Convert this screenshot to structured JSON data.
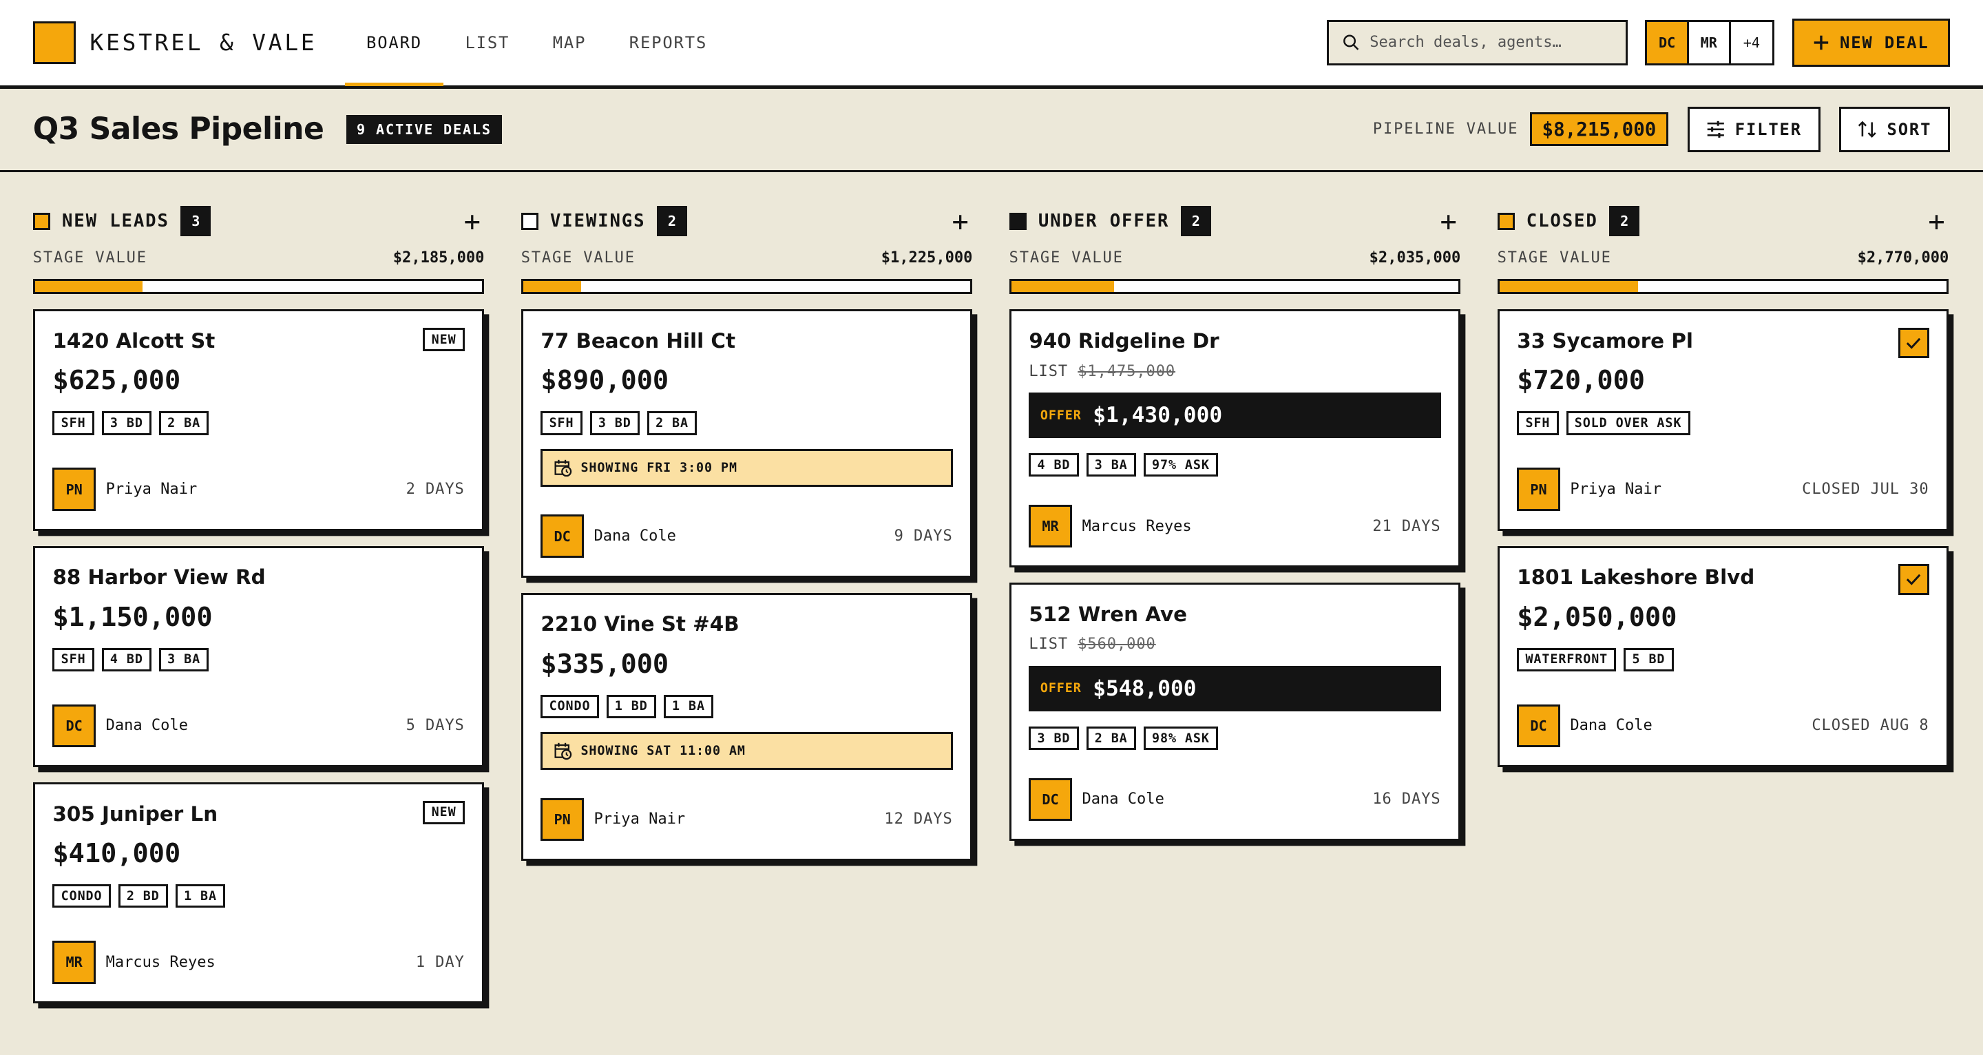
{
  "brand": {
    "name": "KESTREL & VALE"
  },
  "nav": {
    "tabs": [
      {
        "label": "BOARD",
        "active": true
      },
      {
        "label": "LIST"
      },
      {
        "label": "MAP"
      },
      {
        "label": "REPORTS"
      }
    ]
  },
  "search": {
    "placeholder": "Search deals, agents…"
  },
  "team": {
    "avatars": [
      "DC",
      "MR"
    ],
    "more": "+4"
  },
  "actions": {
    "new_deal": "NEW DEAL",
    "filter": "FILTER",
    "sort": "SORT"
  },
  "page": {
    "title": "Q3 Sales Pipeline",
    "active_badge": "9 ACTIVE DEALS",
    "pipeline_label": "PIPELINE VALUE",
    "pipeline_value": "$8,215,000"
  },
  "colors": {
    "accent": "#f5a70c",
    "ink": "#141414",
    "background": "#ece8d9",
    "showing": "#fbe0a3"
  },
  "columns": [
    {
      "title": "NEW LEADS",
      "count": "3",
      "marker": "accent",
      "stage_label": "STAGE VALUE",
      "stage_value": "$2,185,000",
      "progress": 0.24,
      "cards": [
        {
          "address": "1420 Alcott St",
          "price": "$625,000",
          "badge": "NEW",
          "tags": [
            "SFH",
            "3 BD",
            "2 BA"
          ],
          "agent_initials": "PN",
          "agent": "Priya Nair",
          "age": "2 DAYS"
        },
        {
          "address": "88 Harbor View Rd",
          "price": "$1,150,000",
          "tags": [
            "SFH",
            "4 BD",
            "3 BA"
          ],
          "agent_initials": "DC",
          "agent": "Dana Cole",
          "age": "5 DAYS"
        },
        {
          "address": "305 Juniper Ln",
          "price": "$410,000",
          "badge": "NEW",
          "tags": [
            "CONDO",
            "2 BD",
            "1 BA"
          ],
          "agent_initials": "MR",
          "agent": "Marcus Reyes",
          "age": "1 DAY"
        }
      ]
    },
    {
      "title": "VIEWINGS",
      "count": "2",
      "marker": "outline",
      "stage_label": "STAGE VALUE",
      "stage_value": "$1,225,000",
      "progress": 0.13,
      "cards": [
        {
          "address": "77 Beacon Hill Ct",
          "price": "$890,000",
          "tags": [
            "SFH",
            "3 BD",
            "2 BA"
          ],
          "showing": "SHOWING FRI 3:00 PM",
          "agent_initials": "DC",
          "agent": "Dana Cole",
          "age": "9 DAYS"
        },
        {
          "address": "2210 Vine St #4B",
          "price": "$335,000",
          "tags": [
            "CONDO",
            "1 BD",
            "1 BA"
          ],
          "showing": "SHOWING SAT 11:00 AM",
          "agent_initials": "PN",
          "agent": "Priya Nair",
          "age": "12 DAYS"
        }
      ]
    },
    {
      "title": "UNDER OFFER",
      "count": "2",
      "marker": "ink",
      "stage_label": "STAGE VALUE",
      "stage_value": "$2,035,000",
      "progress": 0.23,
      "cards": [
        {
          "address": "940 Ridgeline Dr",
          "list_label": "LIST",
          "list_price": "$1,475,000",
          "offer_label": "OFFER",
          "offer_price": "$1,430,000",
          "tags": [
            "4 BD",
            "3 BA",
            "97% ASK"
          ],
          "agent_initials": "MR",
          "agent": "Marcus Reyes",
          "age": "21 DAYS"
        },
        {
          "address": "512 Wren Ave",
          "list_label": "LIST",
          "list_price": "$560,000",
          "offer_label": "OFFER",
          "offer_price": "$548,000",
          "tags": [
            "3 BD",
            "2 BA",
            "98% ASK"
          ],
          "agent_initials": "DC",
          "agent": "Dana Cole",
          "age": "16 DAYS"
        }
      ]
    },
    {
      "title": "CLOSED",
      "count": "2",
      "marker": "accent",
      "stage_label": "STAGE VALUE",
      "stage_value": "$2,770,000",
      "progress": 0.31,
      "cards": [
        {
          "address": "33 Sycamore Pl",
          "price": "$720,000",
          "checked": true,
          "tags": [
            "SFH",
            "SOLD OVER ASK"
          ],
          "agent_initials": "PN",
          "agent": "Priya Nair",
          "age": "CLOSED JUL 30"
        },
        {
          "address": "1801 Lakeshore Blvd",
          "price": "$2,050,000",
          "checked": true,
          "tags": [
            "WATERFRONT",
            "5 BD"
          ],
          "agent_initials": "DC",
          "agent": "Dana Cole",
          "age": "CLOSED AUG 8"
        }
      ]
    }
  ]
}
